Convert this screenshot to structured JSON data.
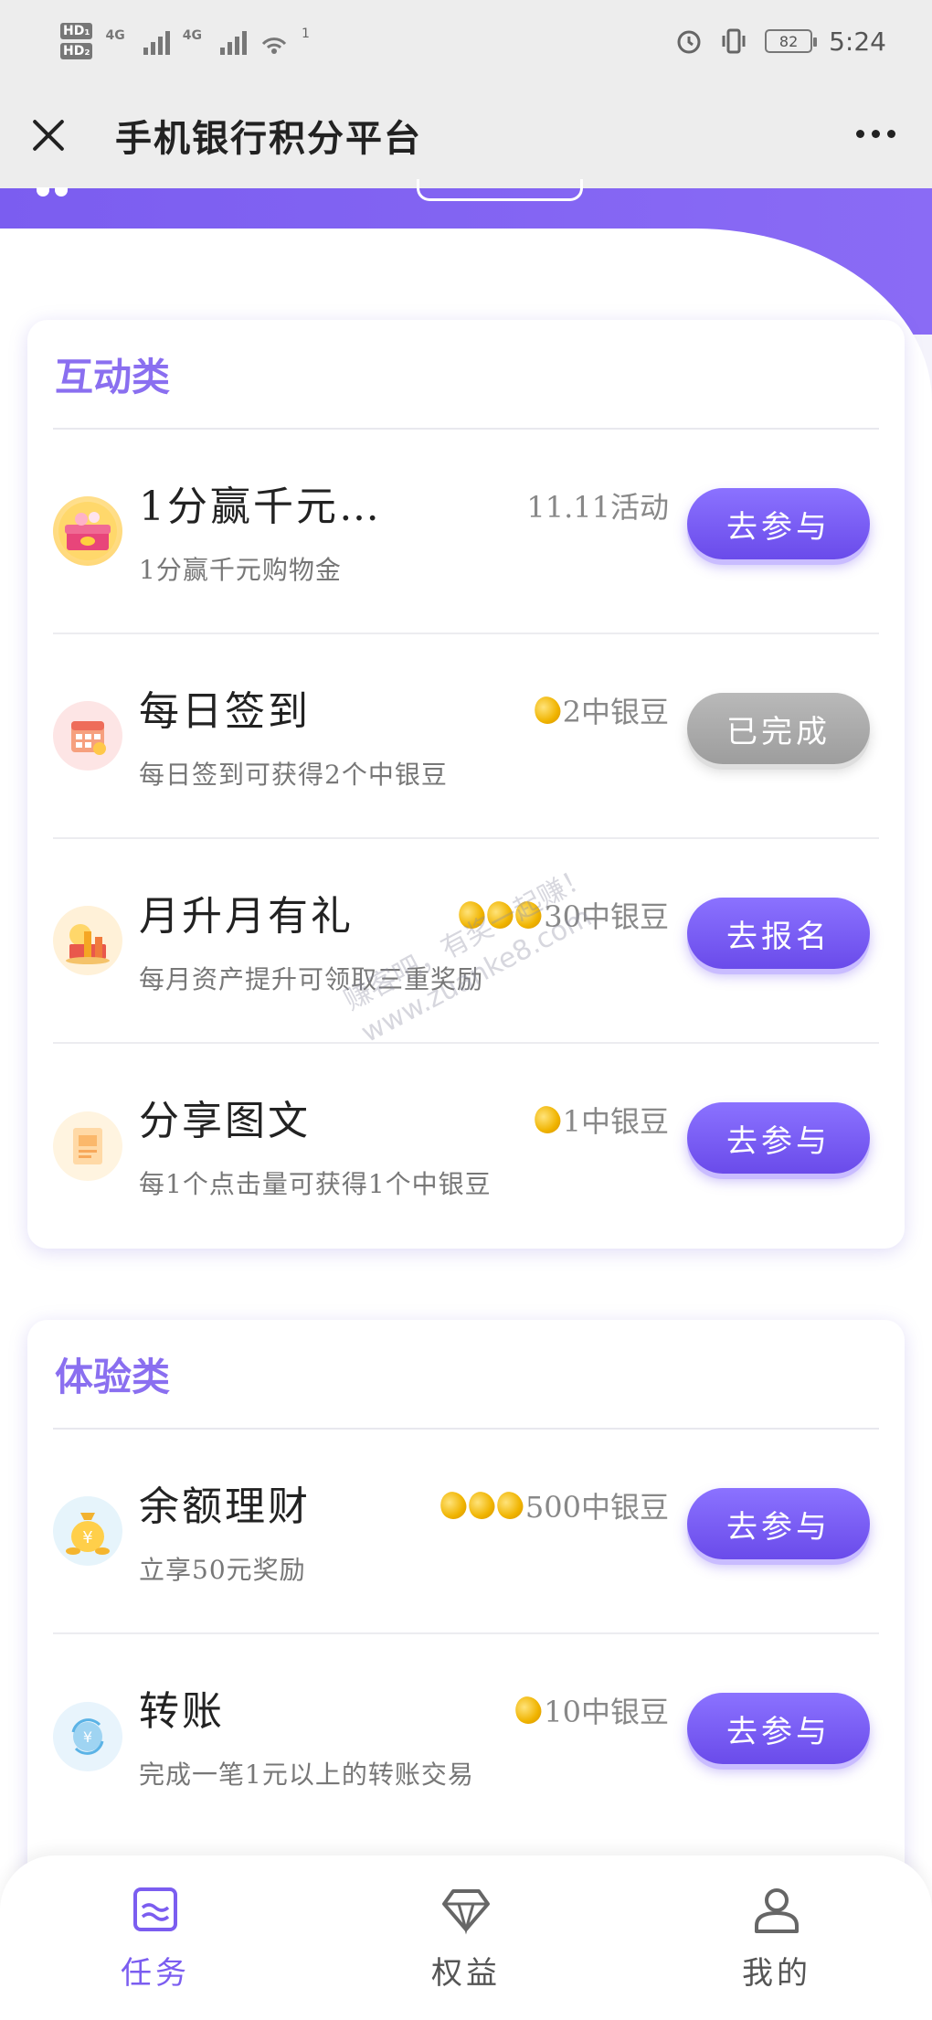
{
  "status_bar": {
    "hd1": "HD₁",
    "hd2": "HD₂",
    "net1": "4G",
    "net2": "4G",
    "wifi_count": "1",
    "battery": "82",
    "time": "5:24"
  },
  "nav": {
    "title": "手机银行积分平台"
  },
  "sections": [
    {
      "title": "互动类",
      "tasks": [
        {
          "name": "1分赢千元…",
          "desc": "1分赢千元购物金",
          "reward": "11.11活动",
          "beans": 0,
          "button": "去参与",
          "button_state": "active"
        },
        {
          "name": "每日签到",
          "desc": "每日签到可获得2个中银豆",
          "reward": "2中银豆",
          "beans": 1,
          "button": "已完成",
          "button_state": "done"
        },
        {
          "name": "月升月有礼",
          "desc": "每月资产提升可领取三重奖励",
          "reward": "30中银豆",
          "beans": 3,
          "button": "去报名",
          "button_state": "active"
        },
        {
          "name": "分享图文",
          "desc": "每1个点击量可获得1个中银豆",
          "reward": "1中银豆",
          "beans": 1,
          "button": "去参与",
          "button_state": "active"
        }
      ]
    },
    {
      "title": "体验类",
      "tasks": [
        {
          "name": "余额理财",
          "desc": "立享50元奖励",
          "reward": "500中银豆",
          "beans": 3,
          "button": "去参与",
          "button_state": "active"
        },
        {
          "name": "转账",
          "desc": "完成一笔1元以上的转账交易",
          "reward": "10中银豆",
          "beans": 1,
          "button": "去参与",
          "button_state": "active"
        }
      ]
    }
  ],
  "watermark": {
    "line1": "赚客吧，有奖一起赚！",
    "line2": "www.zuanke8.com"
  },
  "tabs": [
    {
      "label": "任务",
      "active": true
    },
    {
      "label": "权益",
      "active": false
    },
    {
      "label": "我的",
      "active": false
    }
  ],
  "colors": {
    "accent": "#7b5df0",
    "button": "#6a4bea",
    "button_done": "#a8a8a8",
    "section_title": "#8a6ff0"
  }
}
